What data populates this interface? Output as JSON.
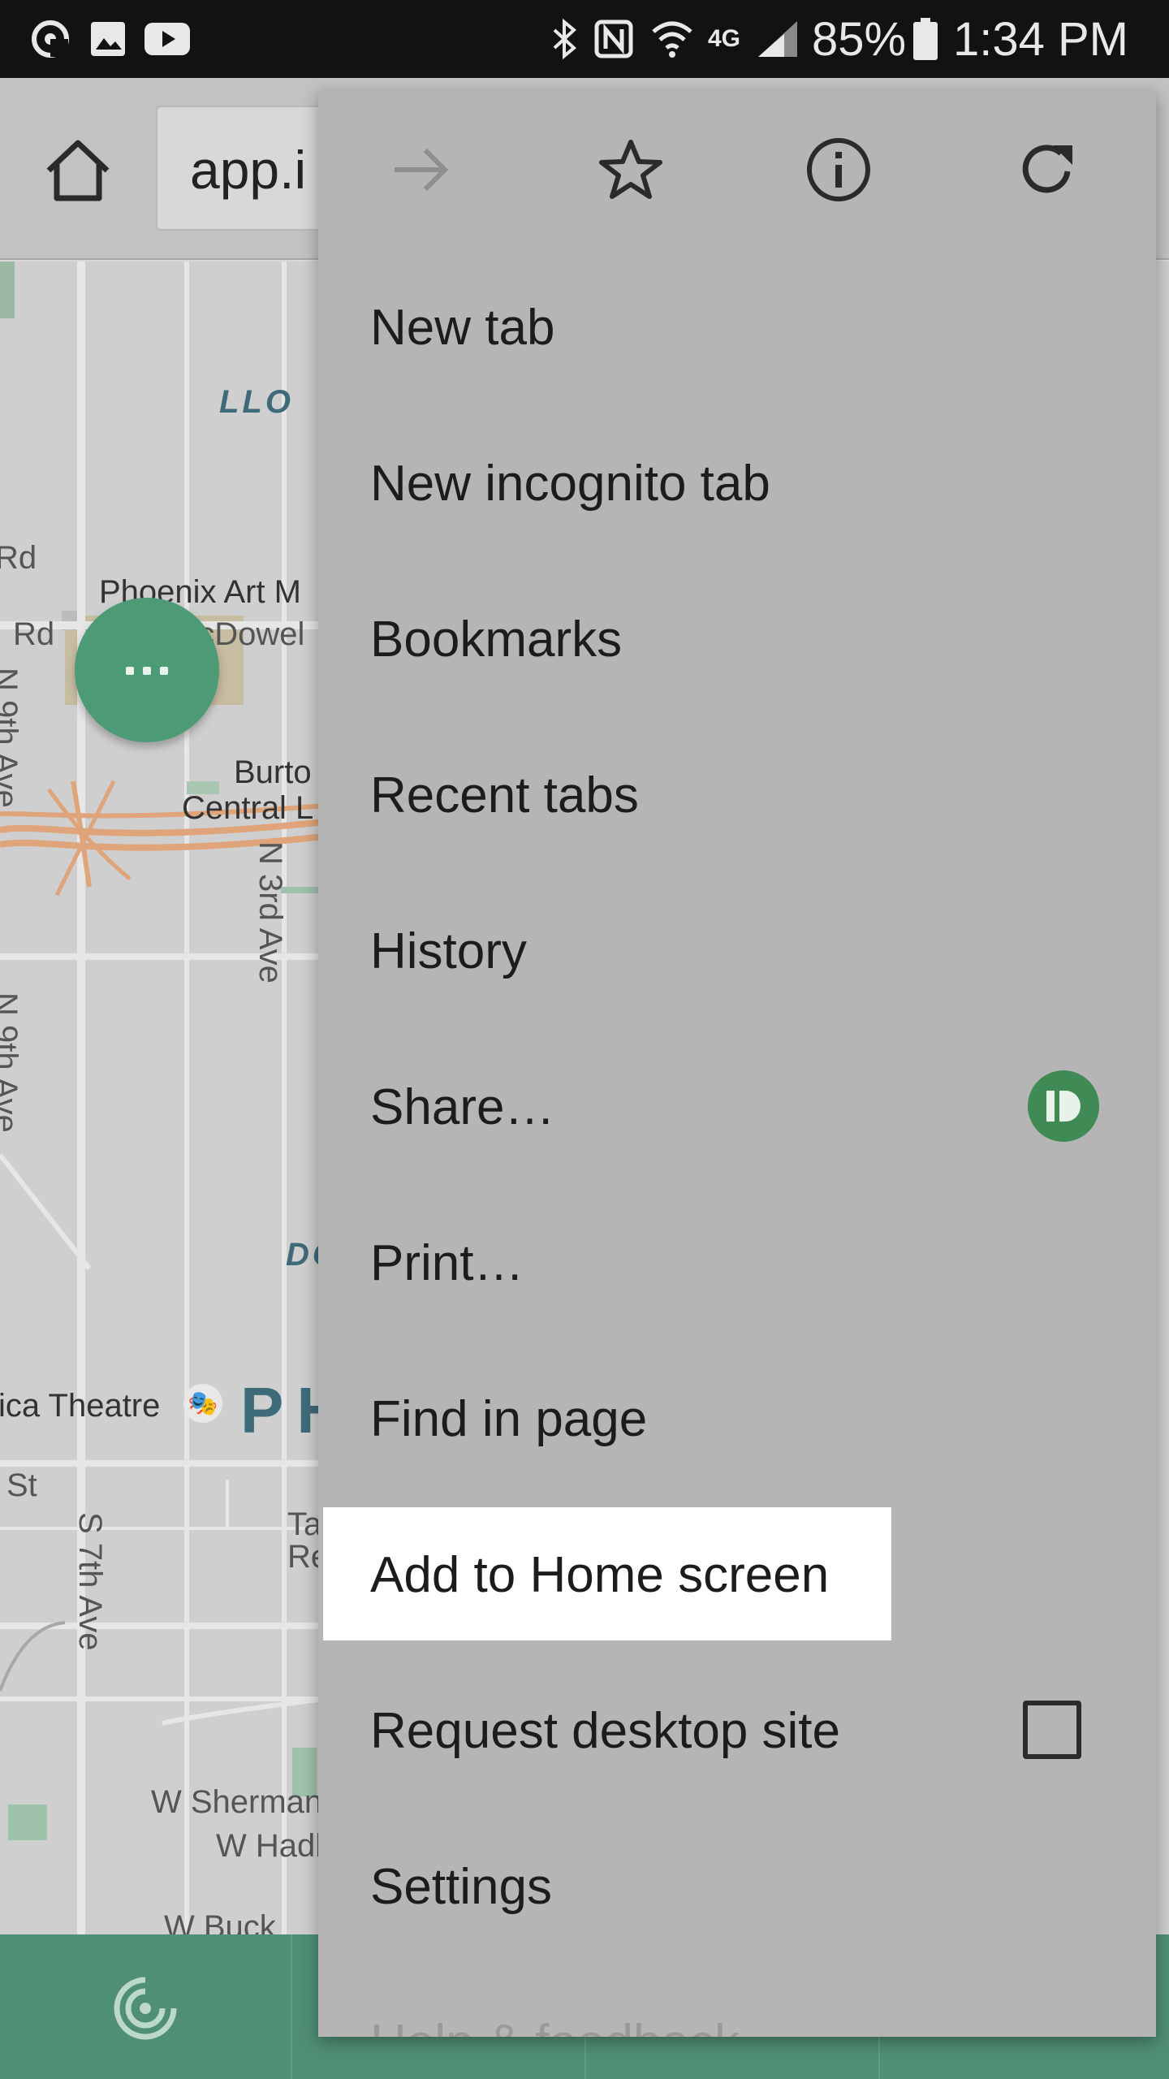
{
  "status_bar": {
    "battery": "85%",
    "time": "1:34 PM",
    "network": "4G",
    "left_icons": [
      "at-sign-icon",
      "image-icon",
      "youtube-icon"
    ],
    "right_icons": [
      "bluetooth-icon",
      "nfc-icon",
      "wifi-icon",
      "lte-icon",
      "signal-icon",
      "battery-icon"
    ]
  },
  "toolbar": {
    "url_text": "app.i"
  },
  "map": {
    "labels": {
      "phoenix_art": "Phoenix Art M",
      "mcdowell": "W McDowel",
      "rd": "Rd",
      "burton": "Burto",
      "central": "Central L",
      "n3rd": "N 3rd Ave",
      "n9th_a": "N 9th Ave",
      "n9th_b": "N 9th Ave",
      "llo": "LLO",
      "do": "DO",
      "theatre": "ica Theatre",
      "phx": "PH",
      "st": "St",
      "s7th": "S 7th Ave",
      "ta": "Ta",
      "re": "Re",
      "sherman": "W Sherman",
      "hadl": "W Hadl",
      "buck": "W Buck"
    }
  },
  "colors": {
    "accent_green": "#4c9a76",
    "menu_bg": "#b5b5b5",
    "bottom_nav": "#4f8f74",
    "share_badge": "#3f8a55"
  },
  "menu": {
    "icons": [
      "forward-icon",
      "star-icon",
      "info-icon",
      "refresh-icon"
    ],
    "items": [
      {
        "label": "New tab"
      },
      {
        "label": "New incognito tab"
      },
      {
        "label": "Bookmarks"
      },
      {
        "label": "Recent tabs"
      },
      {
        "label": "History"
      },
      {
        "label": "Share…"
      },
      {
        "label": "Print…"
      },
      {
        "label": "Find in page"
      },
      {
        "label": "Add to Home screen"
      },
      {
        "label": "Request desktop site",
        "checked": false
      },
      {
        "label": "Settings"
      },
      {
        "label": "Help & feedback"
      }
    ]
  }
}
